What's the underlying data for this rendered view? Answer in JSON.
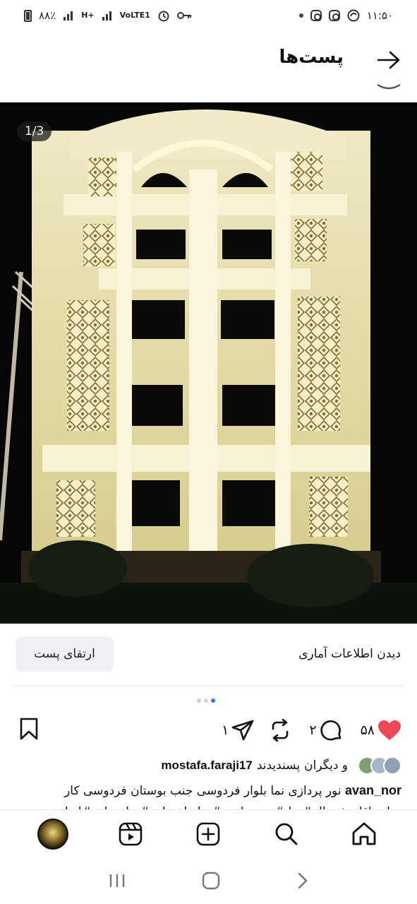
{
  "status_bar": {
    "battery_pct": "٨٨٪",
    "network_1": "H+",
    "network_2": "VoLTE1",
    "time": "۱۱:۵۰"
  },
  "header": {
    "title": "پست‌ها",
    "back_icon": "arrow-right-icon"
  },
  "post": {
    "image_description_icon": "building-facade-photo",
    "counter": "1/3",
    "carousel_total": 3,
    "carousel_active_index": 2
  },
  "actions": {
    "insights_label": "دیدن اطلاعات آماری",
    "boost_label": "ارتقای پست"
  },
  "engagement": {
    "likes": "۵۸",
    "comments": "۲",
    "shares": "۱",
    "like_color": "#ed4956"
  },
  "liked_by": {
    "username": "mostafa.faraji17",
    "suffix": "و دیگران پسندیدند",
    "prefix": "پسندیدند"
  },
  "caption": {
    "username": "avan_nor",
    "text": " نور پردازی نما بلوار فردوسی جنب بوستان فردوسی کار",
    "line2": "جناب اقای فیضاله#نما #نورپردازی #نماساختمان #ساختمان #ایران"
  },
  "bottom_nav": {
    "home": "home-icon",
    "search": "search-icon",
    "create": "create-icon",
    "reels": "reels-icon",
    "profile": "profile-avatar"
  },
  "colors": {
    "accent": "#3478f6",
    "link": "#3b4fb8",
    "like": "#ed4956"
  }
}
